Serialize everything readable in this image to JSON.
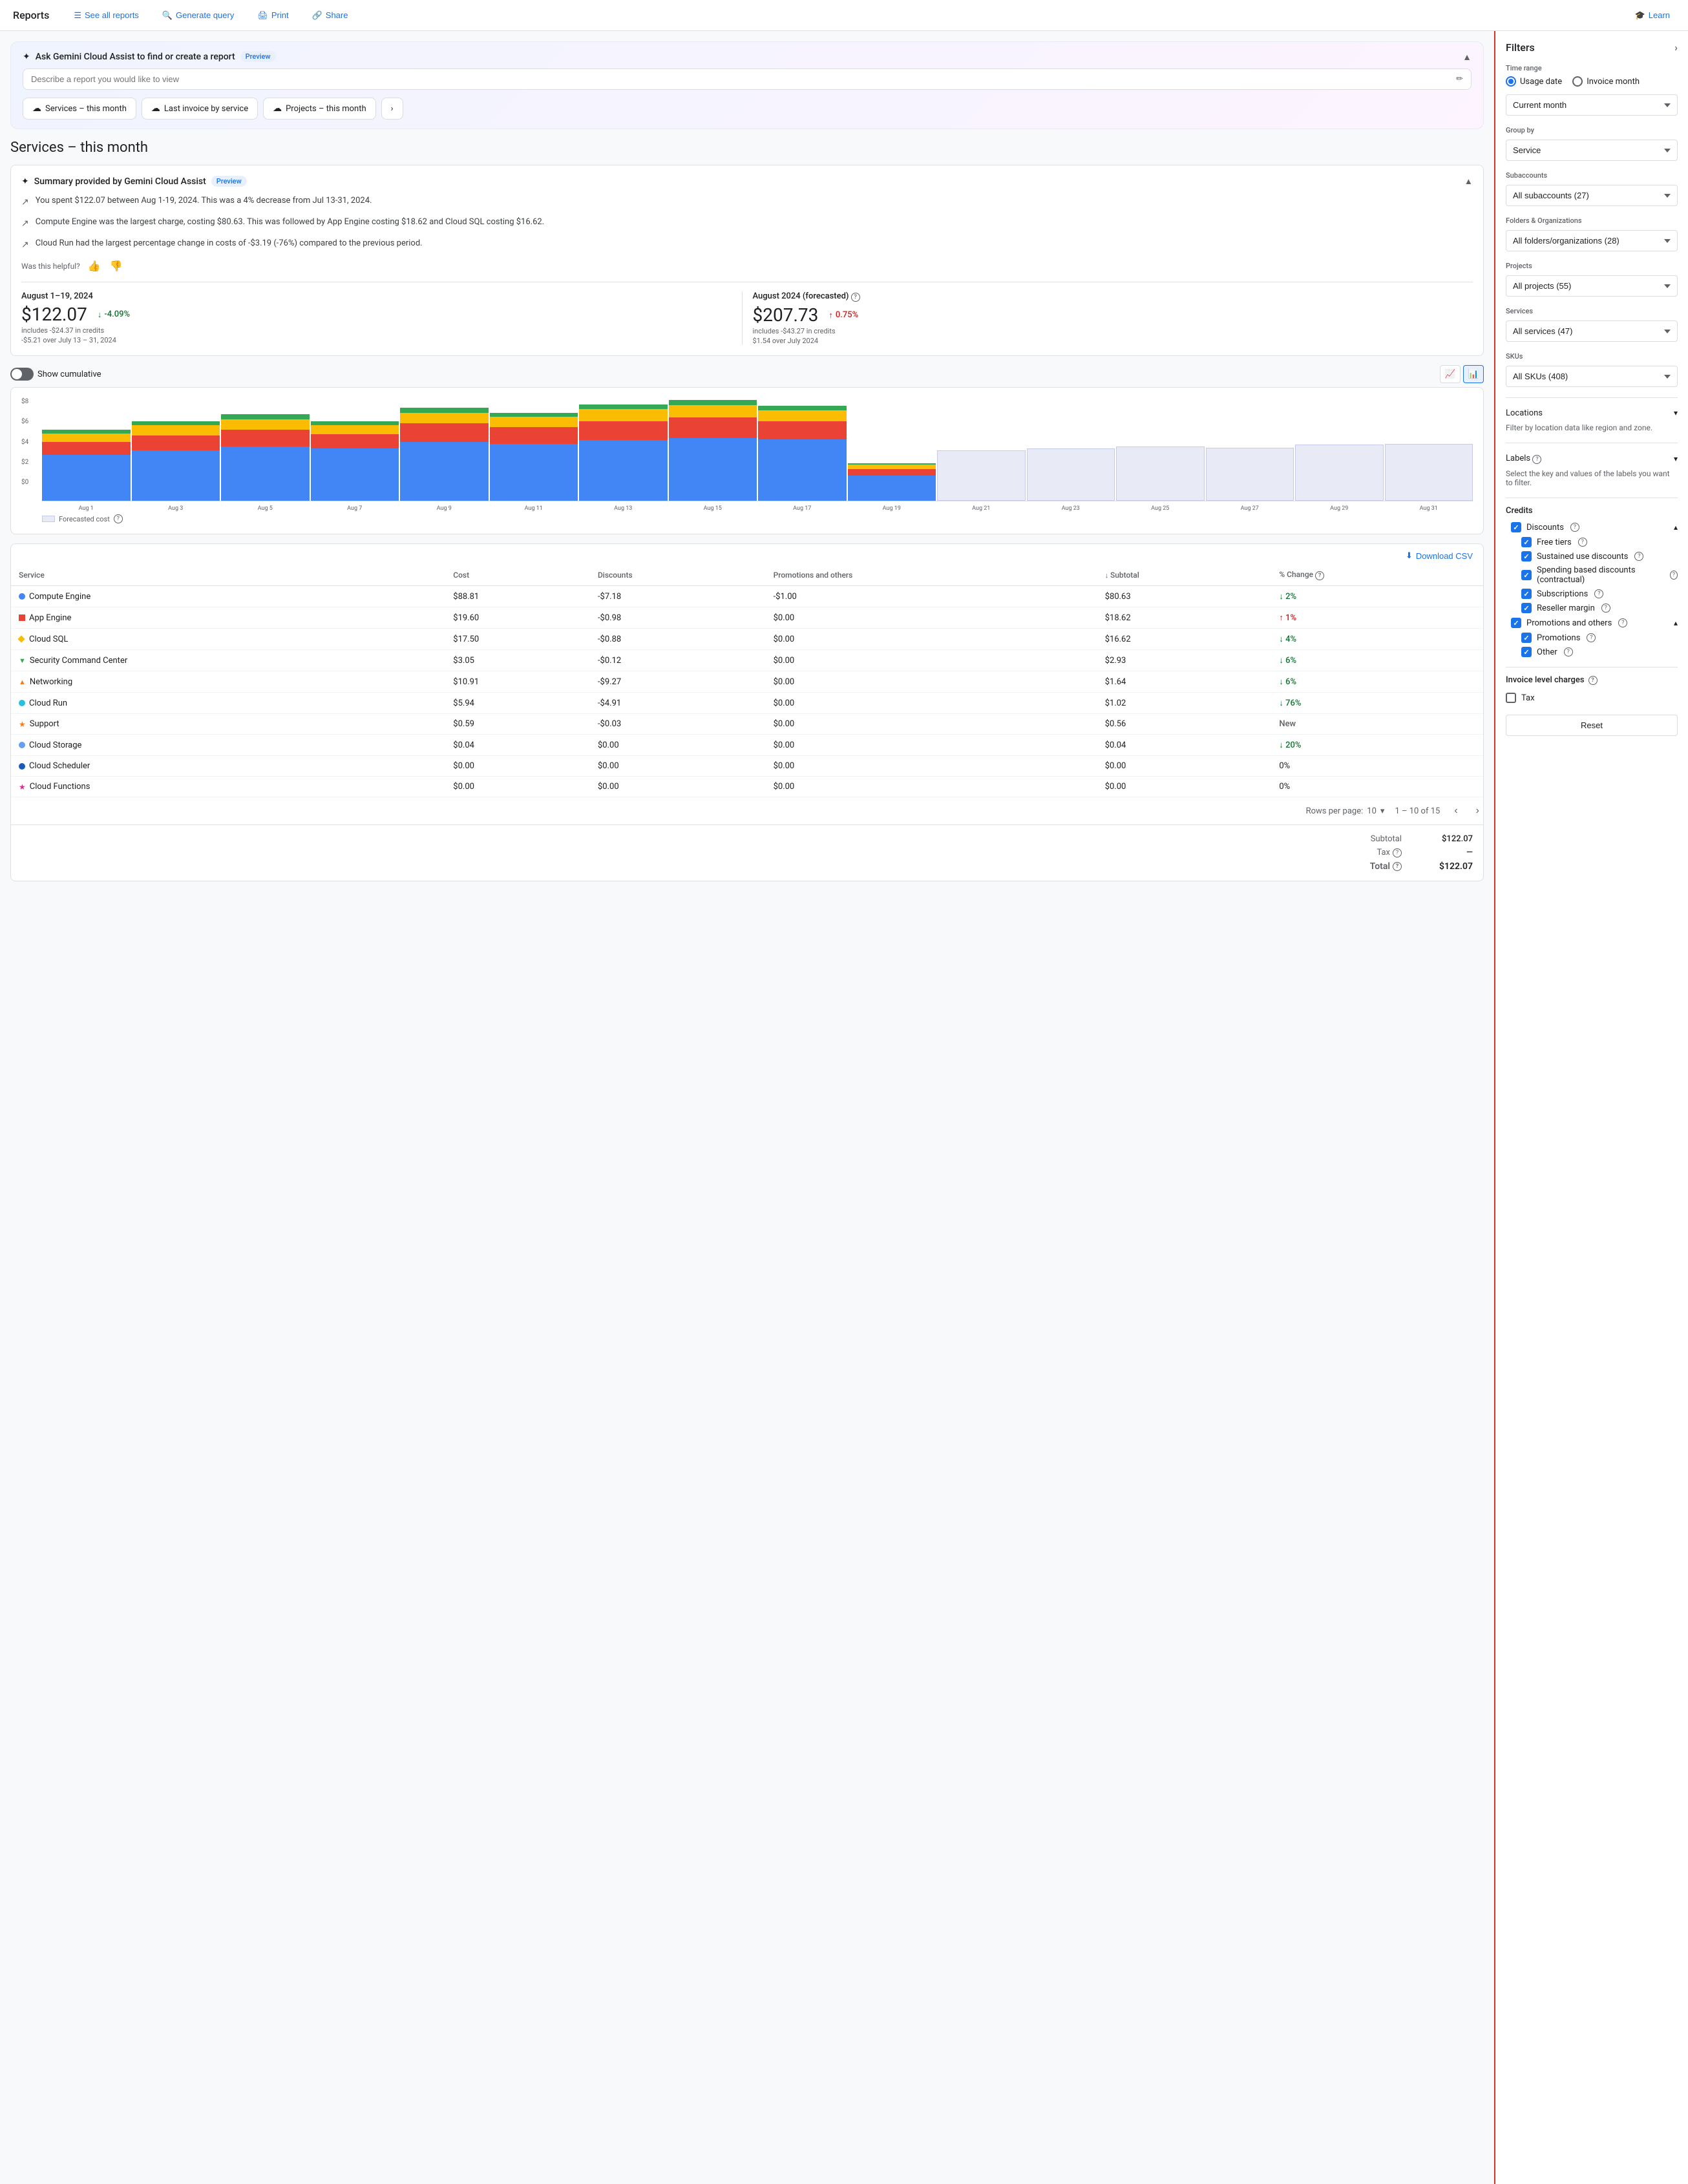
{
  "nav": {
    "brand": "Reports",
    "see_all_reports": "See all reports",
    "generate_query": "Generate query",
    "print": "Print",
    "share": "Share",
    "learn": "Learn"
  },
  "gemini": {
    "title": "Ask Gemini Cloud Assist to find or create a report",
    "preview": "Preview",
    "placeholder": "Describe a report you would like to view",
    "collapse_icon": "▲"
  },
  "report_tabs": [
    {
      "label": "Services – this month"
    },
    {
      "label": "Last invoice by service"
    },
    {
      "label": "Projects – this month"
    }
  ],
  "page_title": "Services – this month",
  "summary": {
    "title": "Summary provided by Gemini Cloud Assist",
    "preview": "Preview",
    "bullets": [
      "You spent $122.07 between Aug 1-19, 2024. This was a 4% decrease from Jul 13-31, 2024.",
      "Compute Engine was the largest charge, costing $80.63. This was followed by App Engine costing $18.62 and Cloud SQL costing $16.62.",
      "Cloud Run had the largest percentage change in costs of -$3.19 (-76%) compared to the previous period."
    ],
    "feedback": "Was this helpful?"
  },
  "metrics": [
    {
      "period": "August 1–19, 2024",
      "value": "$122.07",
      "sub": "includes -$24.37 in credits",
      "change": "-4.09%",
      "change_type": "down",
      "change_sub": "-$5.21 over July 13 – 31, 2024"
    },
    {
      "period": "August 2024 (forecasted)",
      "value": "$207.73",
      "sub": "includes -$43.27 in credits",
      "change": "0.75%",
      "change_type": "up",
      "change_sub": "$1.54 over July 2024"
    }
  ],
  "chart": {
    "show_cumulative": "Show cumulative",
    "y_labels": [
      "$8",
      "$6",
      "$4",
      "$2",
      "$0"
    ],
    "x_labels": [
      "Aug 1",
      "Aug 3",
      "Aug 5",
      "Aug 7",
      "Aug 9",
      "Aug 11",
      "Aug 13",
      "Aug 15",
      "Aug 17",
      "Aug 19",
      "Aug 21",
      "Aug 23",
      "Aug 25",
      "Aug 27",
      "Aug 29",
      "Aug 31"
    ],
    "forecasted_label": "Forecasted cost",
    "bars": [
      {
        "blue": 55,
        "red": 15,
        "orange": 10,
        "yellow": 5,
        "forecasted": false
      },
      {
        "blue": 60,
        "red": 18,
        "orange": 12,
        "yellow": 5,
        "forecasted": false
      },
      {
        "blue": 65,
        "red": 20,
        "orange": 12,
        "yellow": 6,
        "forecasted": false
      },
      {
        "blue": 62,
        "red": 17,
        "orange": 11,
        "yellow": 5,
        "forecasted": false
      },
      {
        "blue": 70,
        "red": 22,
        "orange": 13,
        "yellow": 6,
        "forecasted": false
      },
      {
        "blue": 68,
        "red": 20,
        "orange": 12,
        "yellow": 5,
        "forecasted": false
      },
      {
        "blue": 72,
        "red": 23,
        "orange": 14,
        "yellow": 6,
        "forecasted": false
      },
      {
        "blue": 75,
        "red": 24,
        "orange": 15,
        "yellow": 6,
        "forecasted": false
      },
      {
        "blue": 73,
        "red": 22,
        "orange": 13,
        "yellow": 5,
        "forecasted": false
      },
      {
        "blue": 30,
        "red": 8,
        "orange": 5,
        "yellow": 2,
        "forecasted": false
      },
      {
        "blue": 0,
        "red": 0,
        "orange": 0,
        "yellow": 0,
        "forecasted": true,
        "fcast": 60
      },
      {
        "blue": 0,
        "red": 0,
        "orange": 0,
        "yellow": 0,
        "forecasted": true,
        "fcast": 62
      },
      {
        "blue": 0,
        "red": 0,
        "orange": 0,
        "yellow": 0,
        "forecasted": true,
        "fcast": 65
      },
      {
        "blue": 0,
        "red": 0,
        "orange": 0,
        "yellow": 0,
        "forecasted": true,
        "fcast": 63
      },
      {
        "blue": 0,
        "red": 0,
        "orange": 0,
        "yellow": 0,
        "forecasted": true,
        "fcast": 67
      },
      {
        "blue": 0,
        "red": 0,
        "orange": 0,
        "yellow": 0,
        "forecasted": true,
        "fcast": 68
      }
    ]
  },
  "table": {
    "download": "Download CSV",
    "headers": [
      "Service",
      "Cost",
      "Discounts",
      "Promotions and others",
      "Subtotal",
      "% Change"
    ],
    "rows": [
      {
        "icon": "dot",
        "color": "dot-blue",
        "name": "Compute Engine",
        "cost": "$88.81",
        "discounts": "-$7.18",
        "promotions": "-$1.00",
        "subtotal": "$80.63",
        "change": "2%",
        "change_type": "down"
      },
      {
        "icon": "square",
        "color": "dot-red",
        "name": "App Engine",
        "cost": "$19.60",
        "discounts": "-$0.98",
        "promotions": "$0.00",
        "subtotal": "$18.62",
        "change": "1%",
        "change_type": "up"
      },
      {
        "icon": "diamond",
        "color": "dot-yellow",
        "name": "Cloud SQL",
        "cost": "$17.50",
        "discounts": "-$0.88",
        "promotions": "$0.00",
        "subtotal": "$16.62",
        "change": "4%",
        "change_type": "down"
      },
      {
        "icon": "triangle_down",
        "color": "dot-green",
        "name": "Security Command Center",
        "cost": "$3.05",
        "discounts": "-$0.12",
        "promotions": "$0.00",
        "subtotal": "$2.93",
        "change": "6%",
        "change_type": "down"
      },
      {
        "icon": "triangle_up",
        "color": "dot-orange",
        "name": "Networking",
        "cost": "$10.91",
        "discounts": "-$9.27",
        "promotions": "$0.00",
        "subtotal": "$1.64",
        "change": "6%",
        "change_type": "down"
      },
      {
        "icon": "dot",
        "color": "dot-teal",
        "name": "Cloud Run",
        "cost": "$5.94",
        "discounts": "-$4.91",
        "promotions": "$0.00",
        "subtotal": "$1.02",
        "change": "76%",
        "change_type": "down"
      },
      {
        "icon": "star",
        "color": "dot-orange",
        "name": "Support",
        "cost": "$0.59",
        "discounts": "-$0.03",
        "promotions": "$0.00",
        "subtotal": "$0.56",
        "change": "New",
        "change_type": "new"
      },
      {
        "icon": "dot",
        "color": "dot-lightblue",
        "name": "Cloud Storage",
        "cost": "$0.04",
        "discounts": "$0.00",
        "promotions": "$0.00",
        "subtotal": "$0.04",
        "change": "20%",
        "change_type": "down"
      },
      {
        "icon": "dot",
        "color": "dot-darkblue",
        "name": "Cloud Scheduler",
        "cost": "$0.00",
        "discounts": "$0.00",
        "promotions": "$0.00",
        "subtotal": "$0.00",
        "change": "0%",
        "change_type": "neutral"
      },
      {
        "icon": "star",
        "color": "dot-pink",
        "name": "Cloud Functions",
        "cost": "$0.00",
        "discounts": "$0.00",
        "promotions": "$0.00",
        "subtotal": "$0.00",
        "change": "0%",
        "change_type": "neutral"
      }
    ],
    "pagination": {
      "rows_per_page": "Rows per page:",
      "rows_count": "10",
      "range": "1 – 10 of 15"
    }
  },
  "totals": {
    "subtotal_label": "Subtotal",
    "subtotal_value": "$122.07",
    "tax_label": "Tax",
    "tax_value": "—",
    "total_label": "Total",
    "total_value": "$122.07"
  },
  "filters": {
    "title": "Filters",
    "time_range_label": "Time range",
    "usage_date": "Usage date",
    "invoice_month": "Invoice month",
    "current_month": "Current month",
    "group_by_label": "Group by",
    "group_by_value": "Service",
    "subaccounts_label": "Subaccounts",
    "subaccounts_value": "All subaccounts (27)",
    "folders_label": "Folders & Organizations",
    "folders_value": "All folders/organizations (28)",
    "projects_label": "Projects",
    "projects_value": "All projects (55)",
    "services_label": "Services",
    "services_value": "All services (47)",
    "skus_label": "SKUs",
    "skus_value": "All SKUs (408)",
    "locations_label": "Locations",
    "locations_sub": "Filter by location data like region and zone.",
    "labels_label": "Labels",
    "labels_sub": "Select the key and values of the labels you want to filter.",
    "credits_label": "Credits",
    "discounts_label": "Discounts",
    "free_tiers": "Free tiers",
    "sustained_use": "Sustained use discounts",
    "spending_based": "Spending based discounts (contractual)",
    "subscriptions": "Subscriptions",
    "reseller_margin": "Reseller margin",
    "promotions_others": "Promotions and others",
    "promotions": "Promotions",
    "other": "Other",
    "invoice_charges_label": "Invoice level charges",
    "tax_label_filter": "Tax",
    "reset_label": "Reset"
  }
}
